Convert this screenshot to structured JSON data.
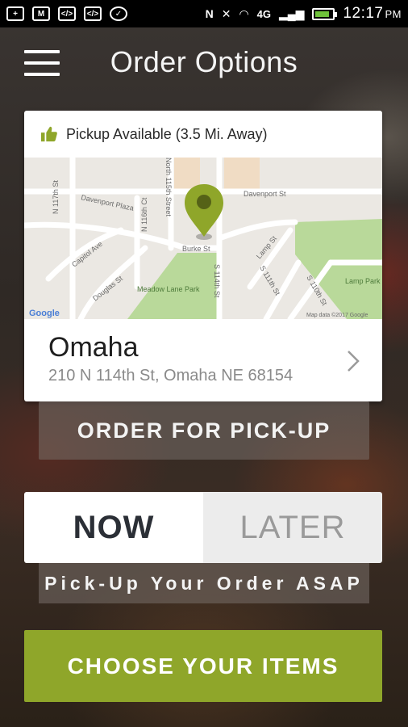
{
  "status_bar": {
    "network": "4G",
    "network_sub": "LTE",
    "time": "12:17",
    "ampm": "PM"
  },
  "header": {
    "title": "Order Options"
  },
  "location_card": {
    "pickup_text": "Pickup Available (3.5 Mi. Away)",
    "city": "Omaha",
    "address": "210 N 114th St, Omaha NE 68154",
    "map": {
      "labels": {
        "n117": "N 117th St",
        "davenport_plaza": "Davenport Plaza",
        "n116": "N 116th Ct",
        "north115": "North 115th Street",
        "davenport_st": "Davenport St",
        "capitol": "Capitol Ave",
        "douglas": "Douglas St",
        "burke": "Burke St",
        "park": "Meadow Lane Park",
        "s114": "S 114th St",
        "lamp": "Lamp St",
        "s111": "S 111th St",
        "s110": "S 110th St",
        "lamp_park": "Lamp Park",
        "copyright": "Map data ©2017 Google",
        "logo": "Google"
      }
    }
  },
  "buttons": {
    "order_pickup": "ORDER FOR PICK-UP",
    "now": "NOW",
    "later": "LATER",
    "asap": "Pick-Up Your Order ASAP",
    "choose_items": "CHOOSE YOUR ITEMS"
  },
  "colors": {
    "accent": "#8fa62a",
    "pin": "#8fa62a",
    "park": "#b9d99a"
  }
}
